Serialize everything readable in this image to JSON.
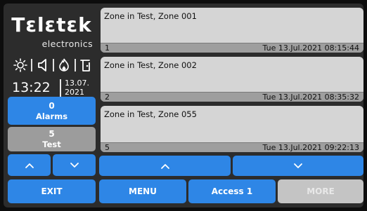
{
  "brand": {
    "name": "Tεlεtεk",
    "subtitle": "electronics"
  },
  "status_icons": [
    "sun-icon",
    "speaker-icon",
    "fire-icon",
    "door-icon"
  ],
  "clock": {
    "time": "13:22",
    "date_day_month": "13.07.",
    "date_year": "2021"
  },
  "counters": {
    "alarms": {
      "count": "0",
      "label": "Alarms"
    },
    "test": {
      "count": "5",
      "label": "Test"
    }
  },
  "events": [
    {
      "text": "Zone in Test, Zone 001",
      "index": "1",
      "timestamp": "Tue 13.Jul.2021 08:15:44"
    },
    {
      "text": "Zone in Test, Zone 002",
      "index": "2",
      "timestamp": "Tue 13.Jul.2021 08:35:32"
    },
    {
      "text": "Zone in Test, Zone 055",
      "index": "5",
      "timestamp": "Tue 13.Jul.2021 09:22:13"
    }
  ],
  "bottom_bar": {
    "exit": "EXIT",
    "menu": "MENU",
    "access": "Access 1",
    "more": "MORE"
  },
  "colors": {
    "accent": "#2e86e6",
    "panel_bg": "#2c2c2c",
    "card_bg": "#d5d5d5",
    "inactive_button": "#9c9c9c",
    "disabled_button": "#c4c4c4"
  }
}
